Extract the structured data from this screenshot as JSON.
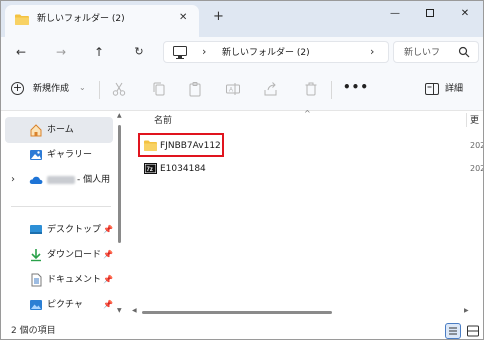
{
  "titlebar": {
    "tab_title": "新しいフォルダー (2)",
    "close_tab": "✕",
    "new_tab": "+",
    "minimize": "—",
    "close_window": "✕"
  },
  "navbar": {
    "back": "←",
    "forward": "→",
    "up": "↑",
    "refresh": "↻",
    "address_separator": "›",
    "address_path": "新しいフォルダー (2)",
    "address_chevron": "›",
    "search_placeholder": "新しいフ"
  },
  "commandbar": {
    "new_label": "新規作成",
    "new_chevron": "⌄",
    "more": "•••",
    "details_label": "詳細",
    "icons": [
      "cut-icon",
      "copy-icon",
      "paste-icon",
      "rename-icon",
      "share-icon",
      "delete-icon"
    ]
  },
  "sidebar": {
    "home": "ホーム",
    "gallery": "ギャラリー",
    "onedrive_suffix": "- 個人用",
    "expand": "›",
    "quick_access": [
      {
        "label": "デスクトップ",
        "pin": "📌"
      },
      {
        "label": "ダウンロード",
        "pin": "📌"
      },
      {
        "label": "ドキュメント",
        "pin": "📌"
      },
      {
        "label": "ピクチャ",
        "pin": "📌"
      }
    ]
  },
  "content": {
    "col_name": "名前",
    "col_sort": "^",
    "col_date": "更",
    "files": [
      {
        "name": "FJNBB7Av112",
        "date": "202",
        "type": "folder"
      },
      {
        "name": "E1034184",
        "date": "202",
        "type": "archive"
      }
    ]
  },
  "statusbar": {
    "item_count": "2 個の項目"
  },
  "colors": {
    "accent": "#0067c0",
    "highlight_box": "#e0141e",
    "folder": "#f3c241",
    "titlebar": "#dfe7f2"
  }
}
